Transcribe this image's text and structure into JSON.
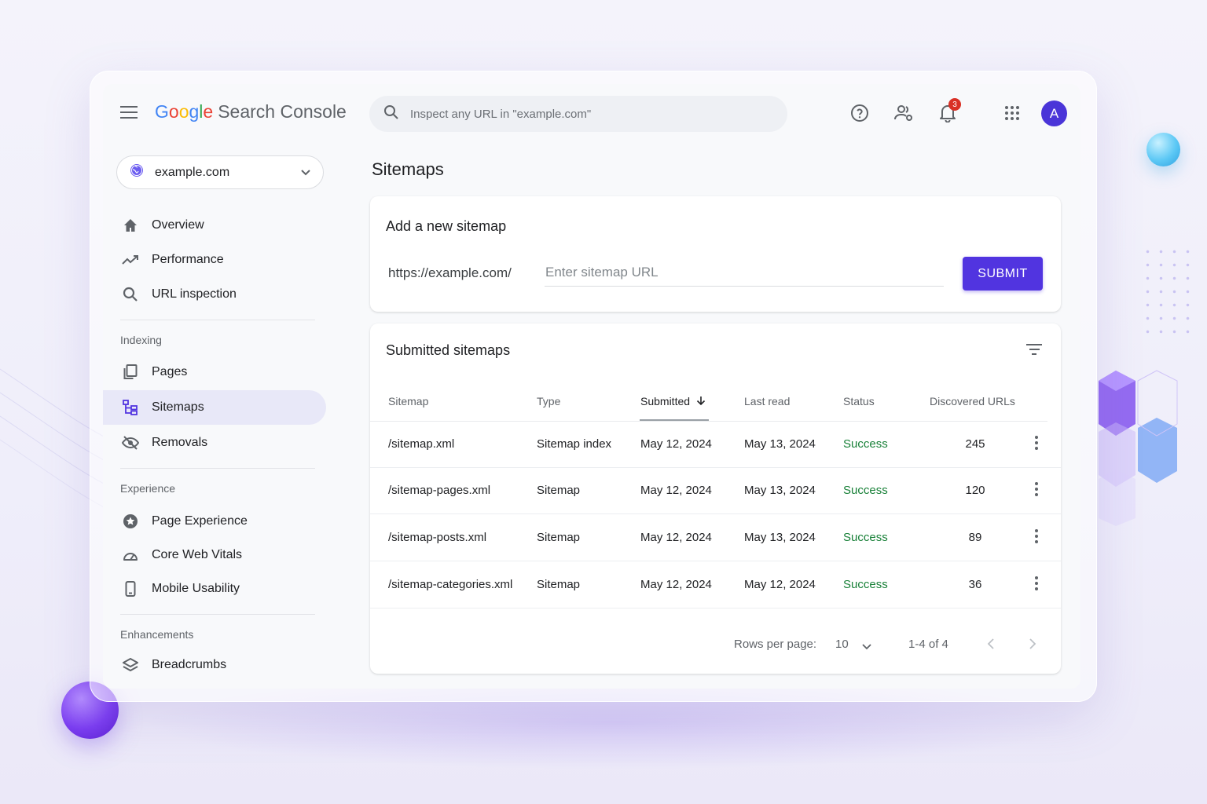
{
  "app": {
    "brand_google": [
      "G",
      "o",
      "o",
      "g",
      "l",
      "e"
    ],
    "brand_product": "Search Console",
    "search_placeholder": "Inspect any URL in \"example.com\"",
    "notification_count": "3",
    "avatar_initial": "A"
  },
  "property": {
    "name": "example.com"
  },
  "sidebar": {
    "items": [
      {
        "label": "Overview",
        "icon": "home-icon"
      },
      {
        "label": "Performance",
        "icon": "trending-icon"
      },
      {
        "label": "URL inspection",
        "icon": "search-icon"
      }
    ],
    "sections": [
      {
        "title": "Indexing",
        "items": [
          {
            "label": "Pages",
            "icon": "pages-icon"
          },
          {
            "label": "Sitemaps",
            "icon": "sitemap-icon",
            "active": true
          },
          {
            "label": "Removals",
            "icon": "eye-off-icon"
          }
        ]
      },
      {
        "title": "Experience",
        "items": [
          {
            "label": "Page Experience",
            "icon": "star-badge-icon"
          },
          {
            "label": "Core Web Vitals",
            "icon": "gauge-icon"
          },
          {
            "label": "Mobile Usability",
            "icon": "phone-icon"
          }
        ]
      },
      {
        "title": "Enhancements",
        "items": [
          {
            "label": "Breadcrumbs",
            "icon": "layers-icon"
          }
        ]
      }
    ]
  },
  "main": {
    "title": "Sitemaps",
    "add_card": {
      "title": "Add a new sitemap",
      "prefix": "https://example.com/",
      "placeholder": "Enter sitemap URL",
      "submit_label": "SUBMIT"
    },
    "list_card": {
      "title": "Submitted sitemaps",
      "columns": [
        "Sitemap",
        "Type",
        "Submitted",
        "Last read",
        "Status",
        "Discovered URLs"
      ],
      "sorted_column": "Submitted",
      "rows": [
        {
          "sitemap": "/sitemap.xml",
          "type": "Sitemap index",
          "submitted": "May 12, 2024",
          "last_read": "May 13, 2024",
          "status": "Success",
          "urls": "245"
        },
        {
          "sitemap": "/sitemap-pages.xml",
          "type": "Sitemap",
          "submitted": "May 12, 2024",
          "last_read": "May 13, 2024",
          "status": "Success",
          "urls": "120"
        },
        {
          "sitemap": "/sitemap-posts.xml",
          "type": "Sitemap",
          "submitted": "May 12, 2024",
          "last_read": "May 13, 2024",
          "status": "Success",
          "urls": "89"
        },
        {
          "sitemap": "/sitemap-categories.xml",
          "type": "Sitemap",
          "submitted": "May 12, 2024",
          "last_read": "May 12, 2024",
          "status": "Success",
          "urls": "36"
        }
      ],
      "pagination": {
        "rows_per_page_label": "Rows per page:",
        "rows_per_page": "10",
        "range": "1-4 of 4"
      }
    }
  },
  "colors": {
    "accent": "#5134e0",
    "success": "#188038",
    "active_nav": "#e8e8f8",
    "avatar": "#4a35d8",
    "badge": "#d93025"
  }
}
